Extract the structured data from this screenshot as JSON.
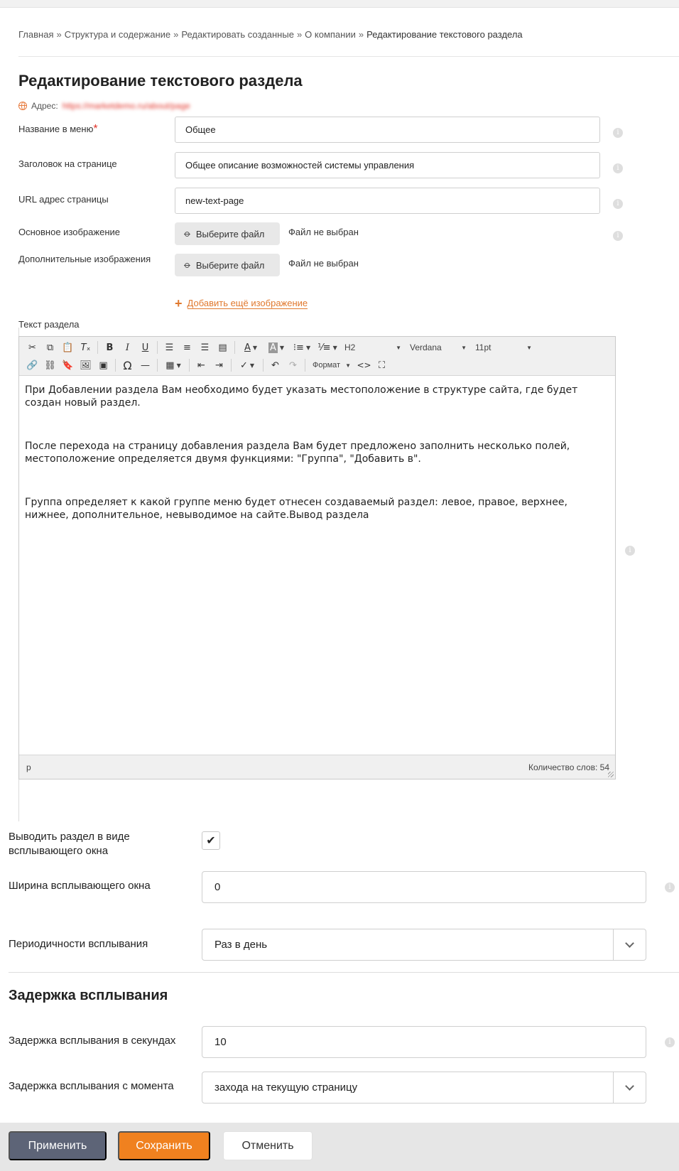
{
  "breadcrumb": {
    "items": [
      "Главная",
      "Структура и содержание",
      "Редактировать созданные",
      "О компании"
    ],
    "current": "Редактирование текстового раздела",
    "separator": "»"
  },
  "page": {
    "title": "Редактирование текстового раздела",
    "address_label": "Адрес:",
    "address_url": "https://marketdemo.ru/about/page"
  },
  "form": {
    "menu_name": {
      "label": "Название в меню",
      "required_mark": "*",
      "value": "Общее"
    },
    "page_heading": {
      "label": "Заголовок на странице",
      "value": "Общее описание возможностей системы управления"
    },
    "url": {
      "label": "URL адрес страницы",
      "value": "new-text-page"
    },
    "main_image": {
      "label": "Основное изображение",
      "button": "Выберите файл",
      "status": "Файл не выбран"
    },
    "extra_images": {
      "label": "Дополнительные изображения",
      "button": "Выберите файл",
      "status": "Файл не выбран"
    },
    "add_more_image": "Добавить ещё изображение",
    "section_text_label": "Текст раздела",
    "info_glyph": "i"
  },
  "editor": {
    "heading_select": "H2",
    "font_select": "Verdana",
    "size_select": "11pt",
    "format_menu": "Формат",
    "paragraphs": [
      "При Добавлении раздела Вам необходимо будет указать местоположение в структуре сайта, где будет создан новый раздел.",
      "После перехода на страницу добавления раздела Вам будет предложено заполнить несколько полей, местоположение определяется двумя функциями: \"Группа\", \"Добавить в\".",
      "Группа определяет к какой группе меню будет отнесен создаваемый раздел: левое, правое, верхнее, нижнее, дополнительное, невыводимое на сайте.Вывод раздела"
    ],
    "status_path": "p",
    "word_count": "Количество слов: 54",
    "toolbar_icons_row1": [
      "cut-icon",
      "copy-icon",
      "paste-icon",
      "clear-format-icon",
      "bold-icon",
      "italic-icon",
      "underline-icon",
      "align-left-icon",
      "align-center-icon",
      "align-right-icon",
      "align-justify-icon",
      "text-color-icon",
      "background-color-icon",
      "bullet-list-icon",
      "numbered-list-icon"
    ],
    "toolbar_icons_row2": [
      "link-icon",
      "unlink-icon",
      "anchor-icon",
      "image-icon",
      "media-icon",
      "special-char-icon",
      "horizontal-rule-icon",
      "table-icon",
      "outdent-icon",
      "indent-icon",
      "spellcheck-icon",
      "undo-icon",
      "redo-icon",
      "code-icon",
      "fullscreen-icon"
    ]
  },
  "popup": {
    "show_as_popup": {
      "label_line1": "Выводить раздел в виде",
      "label_line2": "всплывающего окна",
      "checked": true,
      "check_glyph": "✔"
    },
    "width": {
      "label": "Ширина всплывающего окна",
      "value": "0"
    },
    "frequency": {
      "label": "Периодичности всплывания",
      "value": "Раз в день"
    },
    "delay_section_title": "Задержка всплывания",
    "delay_seconds": {
      "label": "Задержка всплывания в секундах",
      "value": "10"
    },
    "delay_from": {
      "label": "Задержка всплывания с момента",
      "value": "захода на текущую страницу"
    }
  },
  "actions": {
    "apply": "Применить",
    "save": "Сохранить",
    "cancel": "Отменить"
  },
  "colors": {
    "accent_orange": "#f0811f",
    "apply_button": "#5d6477",
    "required": "#e2342a"
  }
}
